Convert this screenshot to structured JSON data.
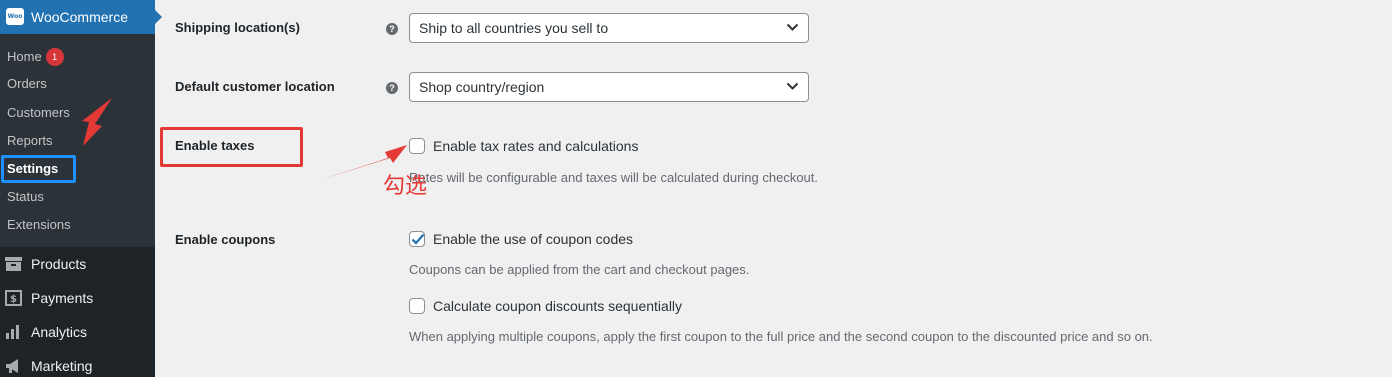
{
  "sidebar": {
    "brand": "WooCommerce",
    "logo_text": "Woo",
    "submenu": [
      {
        "label": "Home",
        "badge": "1"
      },
      {
        "label": "Orders"
      },
      {
        "label": "Customers"
      },
      {
        "label": "Reports"
      },
      {
        "label": "Settings",
        "active": true
      },
      {
        "label": "Status"
      },
      {
        "label": "Extensions"
      }
    ],
    "menu": [
      {
        "label": "Products",
        "icon": "box-icon"
      },
      {
        "label": "Payments",
        "icon": "dollar-icon"
      },
      {
        "label": "Analytics",
        "icon": "bar-chart-icon"
      },
      {
        "label": "Marketing",
        "icon": "megaphone-icon"
      }
    ]
  },
  "settings": {
    "shipping_location": {
      "label": "Shipping location(s)",
      "value": "Ship to all countries you sell to"
    },
    "default_customer_location": {
      "label": "Default customer location",
      "value": "Shop country/region"
    },
    "enable_taxes": {
      "label": "Enable taxes",
      "checkbox_label": "Enable tax rates and calculations",
      "checked": false,
      "description": "Rates will be configurable and taxes will be calculated during checkout."
    },
    "enable_coupons": {
      "label": "Enable coupons",
      "use_coupon_label": "Enable the use of coupon codes",
      "use_coupon_checked": true,
      "use_coupon_desc": "Coupons can be applied from the cart and checkout pages.",
      "sequential_label": "Calculate coupon discounts sequentially",
      "sequential_checked": false,
      "sequential_desc": "When applying multiple coupons, apply the first coupon to the full price and the second coupon to the discounted price and so on."
    }
  },
  "annotation": {
    "text": "勾选",
    "color": "#e53935"
  },
  "colors": {
    "accent": "#2271b1",
    "sidebar": "#1d2327",
    "submenu": "#2c3338",
    "highlight": "#1e90ff"
  }
}
